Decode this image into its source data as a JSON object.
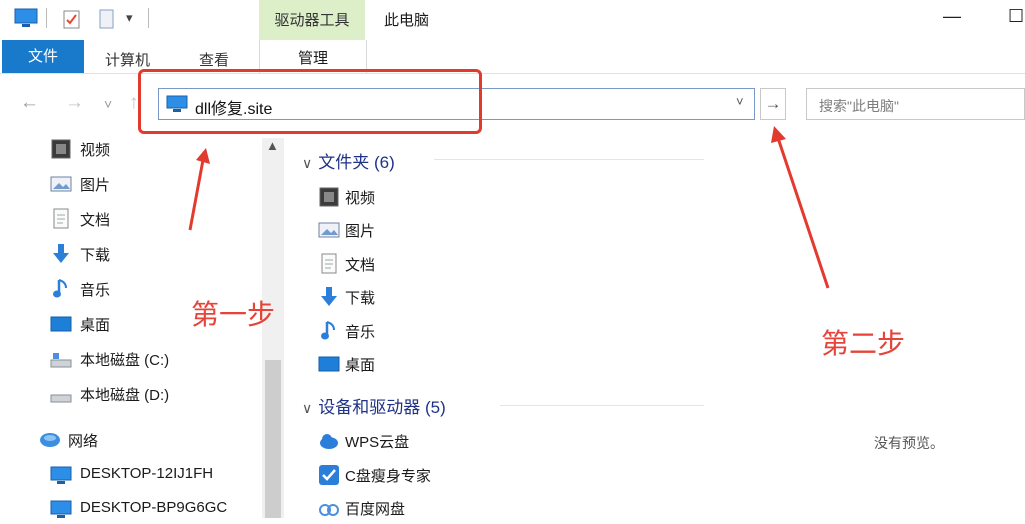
{
  "titlebar": {
    "context_tab": "驱动器工具",
    "title": "此电脑",
    "minimize": "—",
    "maximize": "☐"
  },
  "ribbon": {
    "file": "文件",
    "computer": "计算机",
    "view": "查看",
    "manage": "管理"
  },
  "nav": {
    "back": "←",
    "forward": "→",
    "recent": "˅",
    "up": "↑"
  },
  "address": {
    "value": "dll修复.site",
    "dropdown": "˅",
    "go": "→"
  },
  "search": {
    "placeholder": "搜索\"此电脑\""
  },
  "sidebar": {
    "items": [
      {
        "label": "视频",
        "icon": "video-icon"
      },
      {
        "label": "图片",
        "icon": "pictures-icon"
      },
      {
        "label": "文档",
        "icon": "documents-icon"
      },
      {
        "label": "下载",
        "icon": "download-icon"
      },
      {
        "label": "音乐",
        "icon": "music-icon"
      },
      {
        "label": "桌面",
        "icon": "desktop-icon"
      },
      {
        "label": "本地磁盘 (C:)",
        "icon": "drive-icon"
      },
      {
        "label": "本地磁盘 (D:)",
        "icon": "drive-icon"
      },
      {
        "label": "网络",
        "icon": "network-icon"
      },
      {
        "label": "DESKTOP-12IJ1FH",
        "icon": "computer-icon"
      },
      {
        "label": "DESKTOP-BP9G6GC",
        "icon": "computer-icon"
      }
    ]
  },
  "main": {
    "folders_header": "文件夹 (6)",
    "folders": [
      {
        "label": "视频",
        "icon": "video-icon"
      },
      {
        "label": "图片",
        "icon": "pictures-icon"
      },
      {
        "label": "文档",
        "icon": "documents-icon"
      },
      {
        "label": "下载",
        "icon": "download-icon"
      },
      {
        "label": "音乐",
        "icon": "music-icon"
      },
      {
        "label": "桌面",
        "icon": "desktop-icon"
      }
    ],
    "devices_header": "设备和驱动器 (5)",
    "devices": [
      {
        "label": "WPS云盘",
        "icon": "cloud-icon"
      },
      {
        "label": "C盘瘦身专家",
        "icon": "checkbox-app-icon"
      },
      {
        "label": "百度网盘",
        "icon": "baidu-cloud-icon"
      }
    ]
  },
  "preview": {
    "text": "没有预览。"
  },
  "annotations": {
    "step1": "第一步",
    "step2": "第二步"
  },
  "colors": {
    "accent": "#1979ca",
    "annotation": "#e23b2e",
    "context_tab": "#dcefc9"
  }
}
